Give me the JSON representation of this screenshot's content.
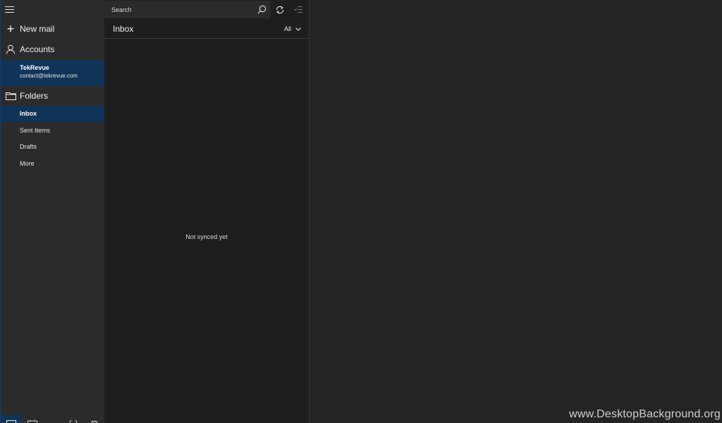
{
  "nav": {
    "new_mail_label": "New mail",
    "accounts_label": "Accounts",
    "account": {
      "name": "TekRevue",
      "email": "contact@tekrevue.com"
    },
    "folders_label": "Folders",
    "folders": [
      {
        "label": "Inbox",
        "selected": true
      },
      {
        "label": "Sent Items",
        "selected": false
      },
      {
        "label": "Drafts",
        "selected": false
      },
      {
        "label": "More",
        "selected": false
      }
    ]
  },
  "list": {
    "search_placeholder": "Search",
    "title": "Inbox",
    "filter_label": "All",
    "empty_message": "Not synced yet"
  },
  "watermark": "www.DesktopBackground.org",
  "colors": {
    "nav_bg": "#2b2b2b",
    "list_bg": "#1e1e1e",
    "reading_bg": "#242424",
    "selection": "#0f3458"
  },
  "icons": {
    "menu": "hamburger-icon",
    "new_mail": "plus-icon",
    "accounts": "person-icon",
    "folders": "folder-icon",
    "search": "search-icon",
    "sync": "sync-icon",
    "select": "selection-mode-icon",
    "filter": "chevron-down-icon"
  }
}
